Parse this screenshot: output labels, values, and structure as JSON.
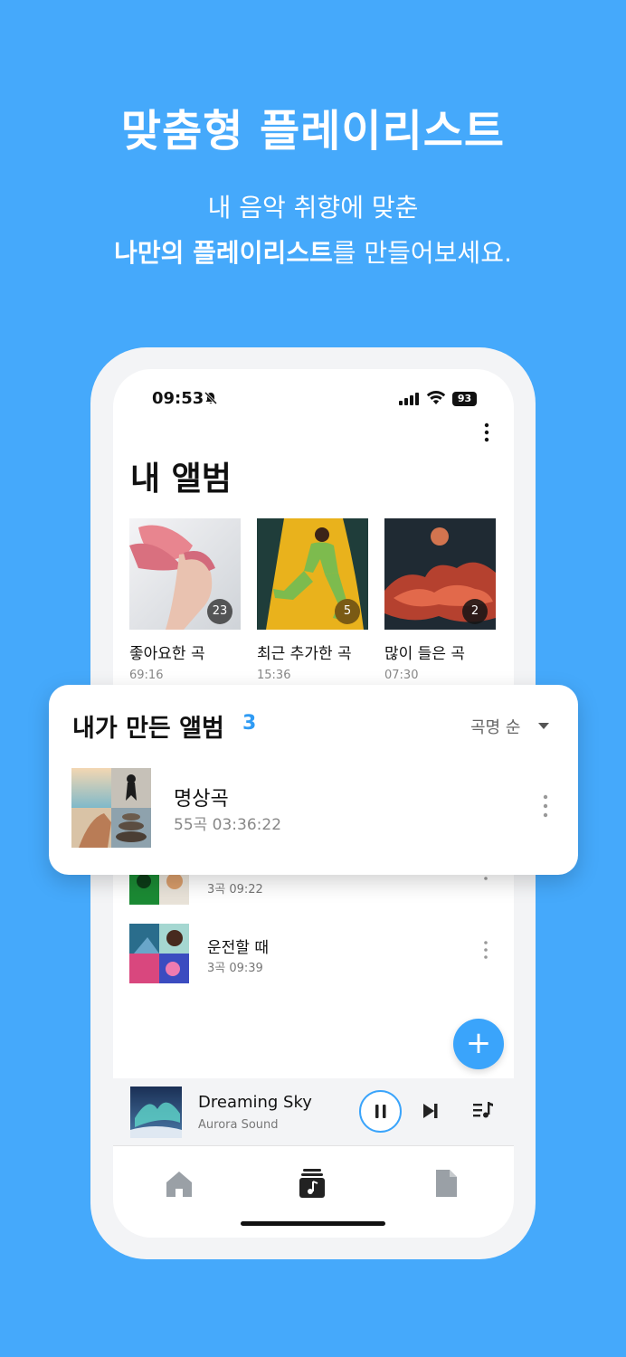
{
  "promo": {
    "headline": "맞춤형 플레이리스트",
    "sub_line1": "내 음악 취향에 맞춘",
    "sub_line2_bold": "나만의 플레이리스트",
    "sub_line2_rest": "를 만들어보세요."
  },
  "status_bar": {
    "time": "09:53",
    "battery": "93",
    "icons": [
      "bell-off-icon",
      "signal-icon",
      "wifi-icon",
      "battery-icon"
    ]
  },
  "page": {
    "title": "내 앨범"
  },
  "albums": [
    {
      "name": "좋아요한 곡",
      "duration": "69:16",
      "count": "23"
    },
    {
      "name": "최근 추가한 곡",
      "duration": "15:36",
      "count": "5"
    },
    {
      "name": "많이 들은 곡",
      "duration": "07:30",
      "count": "2"
    }
  ],
  "my_albums": {
    "title": "내가 만든 앨범",
    "count": "3",
    "sort_label": "곡명 순",
    "items": [
      {
        "name": "명상곡",
        "meta": "55곡  03:36:22"
      },
      {
        "name": "",
        "meta": "3곡  09:22"
      },
      {
        "name": "운전할 때",
        "meta": "3곡  09:39"
      }
    ]
  },
  "fab": {
    "label": "+"
  },
  "player": {
    "track": "Dreaming Sky",
    "artist": "Aurora Sound"
  },
  "tabs": [
    {
      "icon": "home-icon"
    },
    {
      "icon": "album-icon"
    },
    {
      "icon": "document-icon"
    }
  ],
  "colors": {
    "background": "#45a9fb",
    "accent": "#3aa4fb"
  }
}
